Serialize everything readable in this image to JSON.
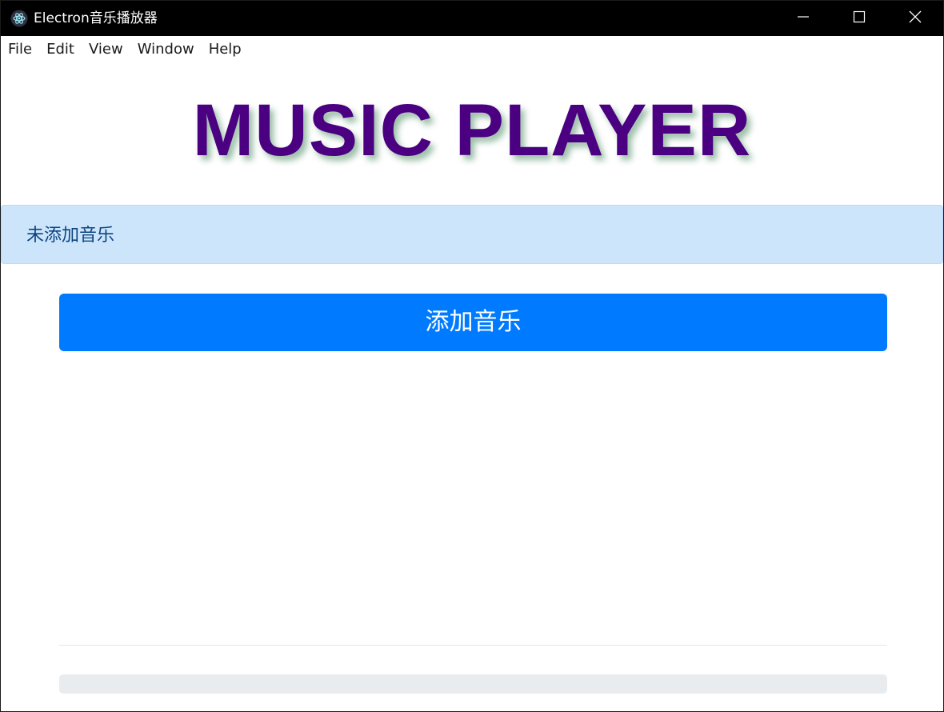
{
  "window": {
    "title": "Electron音乐播放器",
    "controls": {
      "minimize": "minimize-icon",
      "maximize": "maximize-icon",
      "close": "close-icon"
    }
  },
  "menu": {
    "items": [
      {
        "label": "File"
      },
      {
        "label": "Edit"
      },
      {
        "label": "View"
      },
      {
        "label": "Window"
      },
      {
        "label": "Help"
      }
    ]
  },
  "main": {
    "heading": "MUSIC PLAYER",
    "status_alert": "未添加音乐",
    "add_button": "添加音乐",
    "progress": 0
  },
  "colors": {
    "heading": "#4b0082",
    "alert_bg": "#cce5fb",
    "alert_text": "#0c4480",
    "primary": "#007bff",
    "progress_track": "#e9ecef"
  }
}
